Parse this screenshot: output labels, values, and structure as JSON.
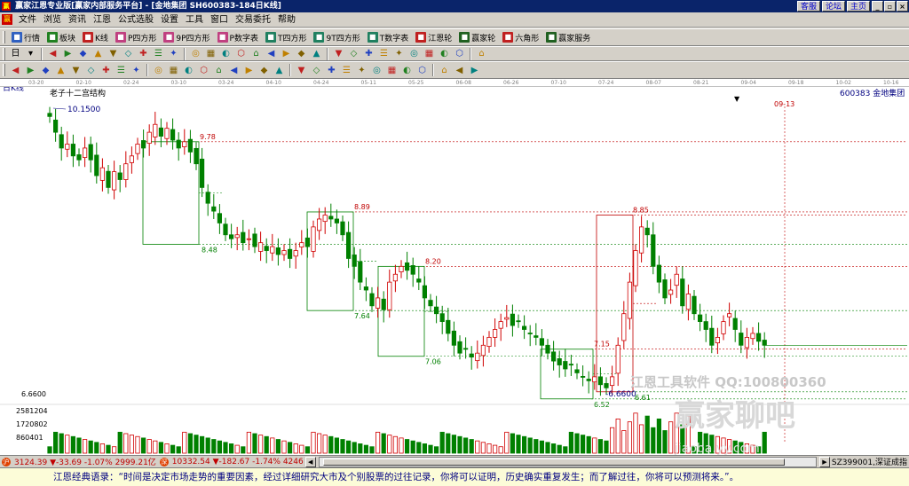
{
  "window": {
    "title": "赢家江恩专业版[赢家内部服务平台] - [金地集团  SH600383-184日K线]",
    "links": [
      "客服",
      "论坛",
      "主页"
    ],
    "buttons": [
      "_",
      "▫",
      "×"
    ]
  },
  "menu": [
    "文件",
    "浏览",
    "资讯",
    "江恩",
    "公式选股",
    "设置",
    "工具",
    "窗口",
    "交易委托",
    "帮助"
  ],
  "toolbar1": [
    {
      "icon": "grid-icon",
      "label": "行情",
      "color": "#3060c0"
    },
    {
      "icon": "blocks-icon",
      "label": "板块",
      "color": "#208020"
    },
    {
      "icon": "kline-icon",
      "label": "K线",
      "color": "#c02020"
    },
    {
      "icon": "p-square-icon",
      "label": "P四方形",
      "color": "#c04080"
    },
    {
      "icon": "9p-square-icon",
      "label": "9P四方形",
      "color": "#c04080"
    },
    {
      "icon": "p-table-icon",
      "label": "P数字表",
      "color": "#c04080"
    },
    {
      "icon": "t-square-icon",
      "label": "T四方形",
      "color": "#208060"
    },
    {
      "icon": "9t-square-icon",
      "label": "9T四方形",
      "color": "#208060"
    },
    {
      "icon": "t-table-icon",
      "label": "T数字表",
      "color": "#208060"
    },
    {
      "icon": "gann-wheel-icon",
      "label": "江恩轮",
      "color": "#c02020"
    },
    {
      "icon": "winner-wheel-icon",
      "label": "赢家轮",
      "color": "#206020"
    },
    {
      "icon": "hexagon-icon",
      "label": "六角形",
      "color": "#c02020"
    },
    {
      "icon": "service-icon",
      "label": "赢家服务",
      "color": "#206020"
    }
  ],
  "toolbar2_icons": [
    "day-period-icon",
    "chart-type-icon",
    "zoom-icon",
    "first-icon",
    "prev-page-icon",
    "prev-icon",
    "next-icon",
    "next-page-icon",
    "last-icon",
    "diamond-tool-icon",
    "diamond-tool-icon",
    "diamond-tool-icon",
    "diamond-tool-icon",
    "diamond-tool-icon",
    "diamond-tool-icon",
    "diamond-tool-icon",
    "diamond-tool-icon",
    "diamond-tool-icon",
    "hand-icon",
    "crosshair-icon",
    "gann-fan-icon",
    "gann-box-icon",
    "gann-grid-icon",
    "text-icon",
    "delete-icon",
    "diamond-tool-icon",
    "diamond-tool-icon",
    "diamond-tool-icon"
  ],
  "toolbar2_labels": {
    "period": "日",
    "zoom": "Q"
  },
  "toolbar3_icons": [
    "line-tool-icon",
    "channel-icon",
    "fib-icon",
    "gann-angle-icon",
    "cycle-icon",
    "square-icon",
    "arc-icon",
    "spiral-icon",
    "wave-icon",
    "triangle-icon",
    "circle-icon",
    "rect-icon",
    "parallel-icon",
    "flag-icon",
    "grid-tool-icon",
    "bars-icon",
    "speed-line-icon",
    "ellipse-icon",
    "arrow-icon",
    "ray-icon",
    "segment-icon",
    "marker-icon",
    "ruler-icon",
    "fan-icon",
    "text-note-icon",
    "pitchfork-icon",
    "eraser-icon",
    "stats-icon",
    "ball-icon",
    "infinity-icon"
  ],
  "date_axis": [
    "03-20",
    "02-10",
    "02-24",
    "03-10",
    "03-24",
    "04-10",
    "04-24",
    "05-11",
    "05-25",
    "06-08",
    "06-26",
    "07-10",
    "07-24",
    "08-07",
    "08-21",
    "09-04",
    "09-18",
    "10-02",
    "10-16"
  ],
  "chart_header": {
    "period_label": "日K线",
    "structure_label": "老子十二宫结构",
    "stock": "600383  金地集团",
    "high_label": "10.1500",
    "low_label": "6.6600",
    "future_date": "09-13",
    "price_axis": "6.6600",
    "volume_axis": [
      "2581204",
      "1720802",
      "860401"
    ],
    "watermark_software": "江恩工具软件  QQ:100800360",
    "watermark_brand": "赢家聊吧",
    "watermark_url": "jiaoba.yy.com"
  },
  "chart_data": {
    "type": "candlestick",
    "price_range": [
      6.45,
      10.25
    ],
    "volume_range": [
      0,
      2800000
    ],
    "levels": [
      {
        "label": "9.78",
        "value": 9.78,
        "color": "#c00000"
      },
      {
        "label": "8.48",
        "value": 8.48,
        "color": "#008000"
      },
      {
        "label": "8.89",
        "value": 8.89,
        "color": "#c00000"
      },
      {
        "label": "7.64",
        "value": 7.64,
        "color": "#008000"
      },
      {
        "label": "8.20",
        "value": 8.2,
        "color": "#c00000"
      },
      {
        "label": "7.06",
        "value": 7.06,
        "color": "#008000"
      },
      {
        "label": "7.15",
        "value": 7.15,
        "color": "#c00000"
      },
      {
        "label": "6.52",
        "value": 6.52,
        "color": "#008000"
      },
      {
        "label": "8.85",
        "value": 8.85,
        "color": "#c00000"
      },
      {
        "label": "6.61",
        "value": 6.61,
        "color": "#008000"
      }
    ],
    "boxes": [
      {
        "hi": 9.78,
        "lo": 8.48,
        "color": "#008000"
      },
      {
        "hi": 8.89,
        "lo": 7.64,
        "color": "#008000"
      },
      {
        "hi": 8.2,
        "lo": 7.06,
        "color": "#008000"
      },
      {
        "hi": 7.15,
        "lo": 6.52,
        "color": "#008000"
      },
      {
        "hi": 8.85,
        "lo": 6.61,
        "color": "#c00000"
      }
    ],
    "closes": [
      10.1,
      9.9,
      9.7,
      9.75,
      9.6,
      9.55,
      9.7,
      9.55,
      9.35,
      9.45,
      9.2,
      9.4,
      9.3,
      9.5,
      9.6,
      9.75,
      9.7,
      9.9,
      10.0,
      9.85,
      9.95,
      9.8,
      9.7,
      9.78,
      9.65,
      9.5,
      9.2,
      9.0,
      8.9,
      8.75,
      8.6,
      8.55,
      8.6,
      8.5,
      8.55,
      8.45,
      8.5,
      8.4,
      8.45,
      8.35,
      8.4,
      8.3,
      8.4,
      8.5,
      8.45,
      8.7,
      8.8,
      8.85,
      8.8,
      8.75,
      8.6,
      8.3,
      8.2,
      8.0,
      7.9,
      7.7,
      7.8,
      7.65,
      8.0,
      8.1,
      8.2,
      8.15,
      8.1,
      8.0,
      7.8,
      7.7,
      7.6,
      7.5,
      7.35,
      7.2,
      7.1,
      7.15,
      7.05,
      7.1,
      7.2,
      7.3,
      7.4,
      7.5,
      7.55,
      7.45,
      7.5,
      7.4,
      7.35,
      7.3,
      7.2,
      7.1,
      7.0,
      6.95,
      6.9,
      6.95,
      6.85,
      6.8,
      6.75,
      6.8,
      6.7,
      6.66,
      6.8,
      7.2,
      7.6,
      8.0,
      8.4,
      8.7,
      8.6,
      8.2,
      8.0,
      7.8,
      7.9,
      8.1,
      7.7,
      7.85,
      7.6,
      7.5,
      7.4,
      7.2,
      7.3,
      7.5,
      7.6,
      7.4,
      7.2,
      7.3,
      7.35,
      7.25,
      7.2
    ]
  },
  "status_quotes": [
    {
      "label": "3124.39 ▼-33.69 -1.07% 2999.21亿",
      "color": "#c00000"
    },
    {
      "label": "10332.54 ▼-182.67 -1.74% 4246",
      "color": "#c00000"
    }
  ],
  "status_right": "SZ399001,深证成指",
  "status_message": "江恩经典语录：“时间是决定市场走势的重要因素，经过详细研究大市及个别股票的过往记录，你将可以证明，历史确实重复发生；而了解过往，你将可以预测将来。”。"
}
